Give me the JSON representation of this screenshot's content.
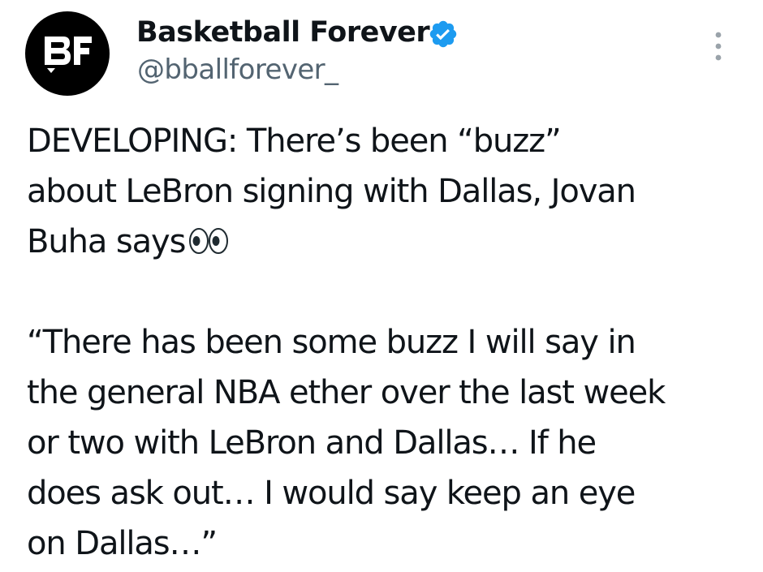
{
  "author": {
    "display_name": "Basketball Forever",
    "handle": "@bballforever_",
    "avatar_label": "BF",
    "verified": true,
    "verified_color": "#1d9bf0"
  },
  "tweet": {
    "lines": [
      "DEVELOPING: There’s been “buzz”",
      "about LeBron signing with Dallas, Jovan",
      "Buha says",
      "",
      "“There has been some buzz I will say in",
      "the general NBA ether over the last week",
      "or two with LeBron and Dallas… If he",
      "does ask out… I would say keep an eye",
      "on Dallas…”"
    ],
    "emoji": "eyes"
  },
  "icons": {
    "more": "more-dots-icon",
    "verified": "verified-badge-icon",
    "eyes": "eyes-emoji-icon"
  },
  "colors": {
    "text": "#0f1419",
    "secondary_text": "#536471",
    "avatar_bg": "#000000"
  }
}
